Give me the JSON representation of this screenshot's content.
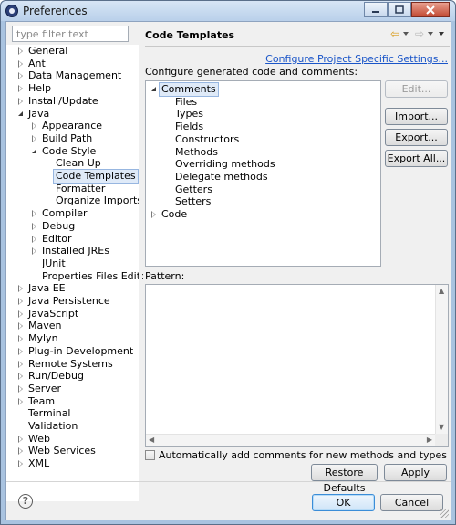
{
  "window": {
    "title": "Preferences",
    "minimize": "0",
    "maximize": "1",
    "close": "r"
  },
  "filter": {
    "placeholder": "type filter text"
  },
  "nav_tree": [
    {
      "label": "General",
      "expand": "collapsed",
      "indent": 0
    },
    {
      "label": "Ant",
      "expand": "collapsed",
      "indent": 0
    },
    {
      "label": "Data Management",
      "expand": "collapsed",
      "indent": 0
    },
    {
      "label": "Help",
      "expand": "collapsed",
      "indent": 0
    },
    {
      "label": "Install/Update",
      "expand": "collapsed",
      "indent": 0
    },
    {
      "label": "Java",
      "expand": "expanded",
      "indent": 0
    },
    {
      "label": "Appearance",
      "expand": "collapsed",
      "indent": 1
    },
    {
      "label": "Build Path",
      "expand": "collapsed",
      "indent": 1
    },
    {
      "label": "Code Style",
      "expand": "expanded",
      "indent": 1
    },
    {
      "label": "Clean Up",
      "expand": "none",
      "indent": 2
    },
    {
      "label": "Code Templates",
      "expand": "none",
      "indent": 2,
      "selected": true
    },
    {
      "label": "Formatter",
      "expand": "none",
      "indent": 2
    },
    {
      "label": "Organize Imports",
      "expand": "none",
      "indent": 2
    },
    {
      "label": "Compiler",
      "expand": "collapsed",
      "indent": 1
    },
    {
      "label": "Debug",
      "expand": "collapsed",
      "indent": 1
    },
    {
      "label": "Editor",
      "expand": "collapsed",
      "indent": 1
    },
    {
      "label": "Installed JREs",
      "expand": "collapsed",
      "indent": 1
    },
    {
      "label": "JUnit",
      "expand": "none",
      "indent": 1
    },
    {
      "label": "Properties Files Editor",
      "expand": "none",
      "indent": 1
    },
    {
      "label": "Java EE",
      "expand": "collapsed",
      "indent": 0
    },
    {
      "label": "Java Persistence",
      "expand": "collapsed",
      "indent": 0
    },
    {
      "label": "JavaScript",
      "expand": "collapsed",
      "indent": 0
    },
    {
      "label": "Maven",
      "expand": "collapsed",
      "indent": 0
    },
    {
      "label": "Mylyn",
      "expand": "collapsed",
      "indent": 0
    },
    {
      "label": "Plug-in Development",
      "expand": "collapsed",
      "indent": 0
    },
    {
      "label": "Remote Systems",
      "expand": "collapsed",
      "indent": 0
    },
    {
      "label": "Run/Debug",
      "expand": "collapsed",
      "indent": 0
    },
    {
      "label": "Server",
      "expand": "collapsed",
      "indent": 0
    },
    {
      "label": "Team",
      "expand": "collapsed",
      "indent": 0
    },
    {
      "label": "Terminal",
      "expand": "none",
      "indent": 0
    },
    {
      "label": "Validation",
      "expand": "none",
      "indent": 0
    },
    {
      "label": "Web",
      "expand": "collapsed",
      "indent": 0
    },
    {
      "label": "Web Services",
      "expand": "collapsed",
      "indent": 0
    },
    {
      "label": "XML",
      "expand": "collapsed",
      "indent": 0
    }
  ],
  "page": {
    "title": "Code Templates",
    "configure_link": "Configure Project Specific Settings...",
    "description": "Configure generated code and comments:",
    "pattern_label": "Pattern:",
    "auto_comments": "Automatically add comments for new methods and types",
    "restore_defaults": "Restore Defaults",
    "apply": "Apply"
  },
  "templates_tree": [
    {
      "label": "Comments",
      "expand": "expanded",
      "indent": 0,
      "selected": true
    },
    {
      "label": "Files",
      "expand": "none",
      "indent": 1
    },
    {
      "label": "Types",
      "expand": "none",
      "indent": 1
    },
    {
      "label": "Fields",
      "expand": "none",
      "indent": 1
    },
    {
      "label": "Constructors",
      "expand": "none",
      "indent": 1
    },
    {
      "label": "Methods",
      "expand": "none",
      "indent": 1
    },
    {
      "label": "Overriding methods",
      "expand": "none",
      "indent": 1
    },
    {
      "label": "Delegate methods",
      "expand": "none",
      "indent": 1
    },
    {
      "label": "Getters",
      "expand": "none",
      "indent": 1
    },
    {
      "label": "Setters",
      "expand": "none",
      "indent": 1
    },
    {
      "label": "Code",
      "expand": "collapsed",
      "indent": 0
    }
  ],
  "side_buttons": {
    "edit": "Edit...",
    "import": "Import...",
    "export": "Export...",
    "export_all": "Export All..."
  },
  "footer": {
    "help": "?",
    "ok": "OK",
    "cancel": "Cancel"
  }
}
